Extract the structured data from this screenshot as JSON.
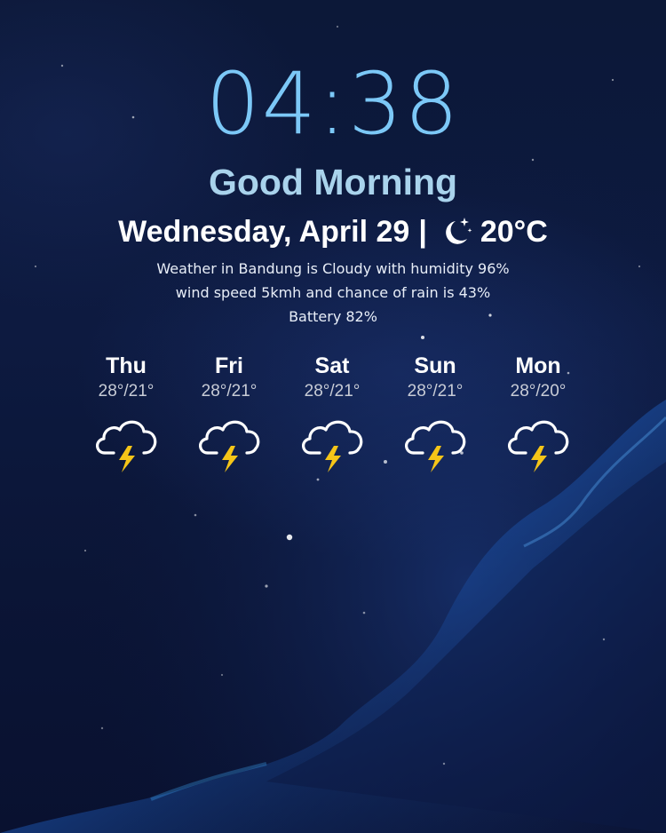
{
  "lockscreen": {
    "time": "04:38",
    "greeting": "Good Morning",
    "date": "Wednesday, April 29",
    "separator": "|",
    "current_condition_icon": "moon-stars-icon",
    "temperature": "20°C",
    "summary_line1": "Weather in Bandung is Cloudy with humidity 96%",
    "summary_line2": "wind speed 5kmh and chance of rain is 43%",
    "battery": "Battery 82%"
  },
  "forecast": [
    {
      "day": "Thu",
      "temps": "28°/21°",
      "icon": "thunderstorm-icon"
    },
    {
      "day": "Fri",
      "temps": "28°/21°",
      "icon": "thunderstorm-icon"
    },
    {
      "day": "Sat",
      "temps": "28°/21°",
      "icon": "thunderstorm-icon"
    },
    {
      "day": "Sun",
      "temps": "28°/21°",
      "icon": "thunderstorm-icon"
    },
    {
      "day": "Mon",
      "temps": "28°/20°",
      "icon": "thunderstorm-icon"
    }
  ],
  "colors": {
    "clock": "#7cc8f7",
    "greeting": "#a9d3ec",
    "text": "#ffffff",
    "temp_range": "#c8ccd6",
    "bolt": "#f5c518"
  }
}
